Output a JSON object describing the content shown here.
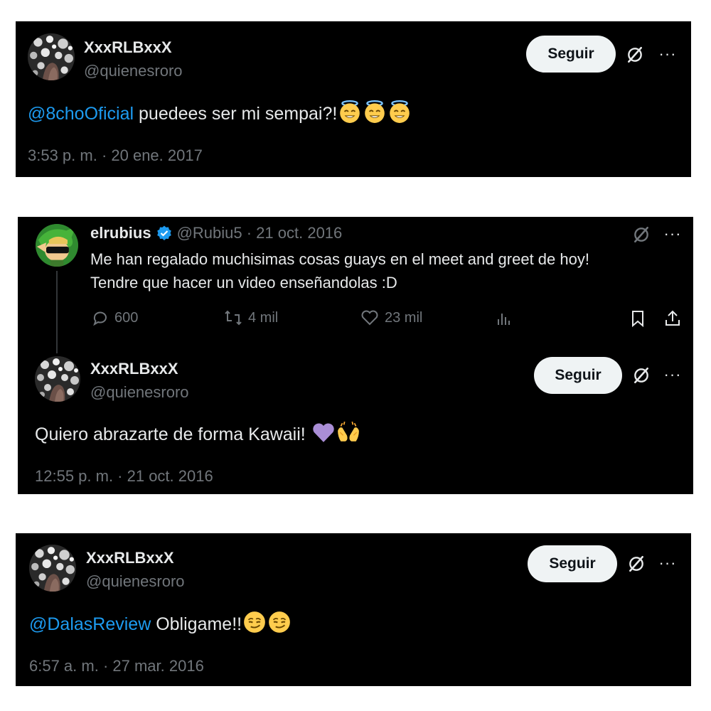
{
  "tweet1": {
    "name": "XxxRLBxxX",
    "handle": "@quienesroro",
    "follow_label": "Seguir",
    "mention": "@8choOficial",
    "text": " puedees ser mi sempai?!",
    "emojis": [
      "smiling-face-with-halo-emoji",
      "smiling-face-with-halo-emoji",
      "smiling-face-with-halo-emoji"
    ],
    "timestamp": "3:53 p. m. · 20 ene. 2017"
  },
  "tweet2": {
    "quoted": {
      "name": "elrubius",
      "verified_icon": "verified-badge-icon",
      "handle_date": "@Rubiu5 · 21 oct. 2016",
      "line1": "Me han regalado muchisimas cosas guays en el meet and greet de hoy!",
      "line2": "Tendre que hacer un video enseñandolas :D",
      "replies": "600",
      "retweets": "4 mil",
      "likes": "23 mil"
    },
    "reply": {
      "name": "XxxRLBxxX",
      "handle": "@quienesroro",
      "follow_label": "Seguir",
      "text": "Quiero abrazarte de forma Kawaii! ",
      "emojis": [
        "purple-heart-emoji",
        "open-hands-emoji"
      ],
      "timestamp": "12:55 p. m. · 21 oct. 2016"
    }
  },
  "tweet3": {
    "name": "XxxRLBxxX",
    "handle": "@quienesroro",
    "follow_label": "Seguir",
    "mention": "@DalasReview",
    "text": " Obligame!!",
    "emojis": [
      "smirking-face-emoji",
      "smirking-face-emoji"
    ],
    "timestamp": "6:57 a. m. · 27 mar. 2016"
  },
  "colors": {
    "background": "#000000",
    "text": "#e7e9ea",
    "muted": "#71767b",
    "link": "#1d9bf0",
    "follow_button": "#eff3f4",
    "verified": "#1d9bf0"
  }
}
